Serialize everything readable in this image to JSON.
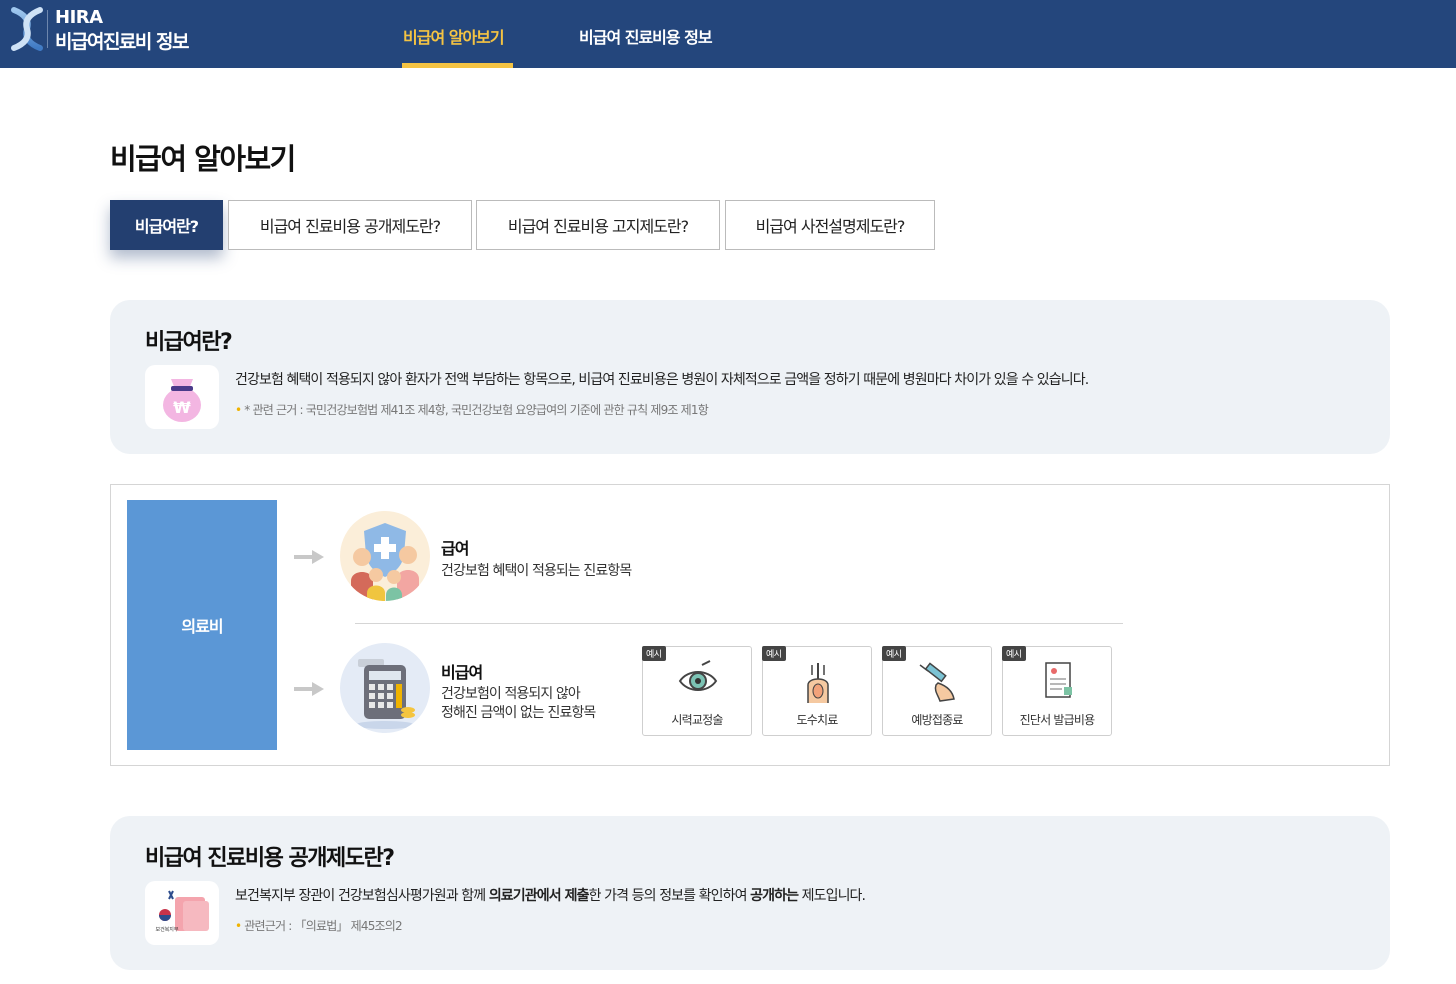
{
  "header": {
    "logo_line1": "HIRA",
    "logo_line2": "비급여진료비 정보",
    "nav": [
      {
        "label": "비급여 알아보기",
        "active": true
      },
      {
        "label": "비급여 진료비용 정보",
        "active": false
      }
    ]
  },
  "page_title": "비급여 알아보기",
  "tabs": [
    {
      "label": "비급여란?",
      "active": true
    },
    {
      "label": "비급여 진료비용 공개제도란?",
      "active": false
    },
    {
      "label": "비급여 진료비용 고지제도란?",
      "active": false
    },
    {
      "label": "비급여 사전설명제도란?",
      "active": false
    }
  ],
  "section1": {
    "title": "비급여란?",
    "icon": "money-bag-icon",
    "description": "건강보험 혜택이 적용되지 않아 환자가 전액 부담하는 항목으로, 비급여 진료비용은 병원이 자체적으로 금액을 정하기 때문에 병원마다 차이가 있을 수 있습니다.",
    "note": "* 관련 근거 : 국민건강보험법 제41조 제4항, 국민건강보험 요양급여의 기준에 관한 규칙 제9조 제1항"
  },
  "diagram": {
    "root_label": "의료비",
    "covered": {
      "title": "급여",
      "description": "건강보험 혜택이 적용되는 진료항목",
      "icon": "family-shield-icon"
    },
    "non_covered": {
      "title": "비급여",
      "description_line1": "건강보험이 적용되지 않아",
      "description_line2": "정해진 금액이 없는 진료항목",
      "icon": "calculator-icon"
    },
    "examples": [
      {
        "badge": "예시",
        "label": "시력교정술",
        "icon": "eye-icon"
      },
      {
        "badge": "예시",
        "label": "도수치료",
        "icon": "massage-icon"
      },
      {
        "badge": "예시",
        "label": "예방접종료",
        "icon": "syringe-icon"
      },
      {
        "badge": "예시",
        "label": "진단서 발급비용",
        "icon": "certificate-icon"
      }
    ]
  },
  "section2": {
    "title": "비급여 진료비용 공개제도란?",
    "icon": "ministry-card-icon",
    "desc_part1": "보건복지부 장관이 건강보험심사평가원과 함께 ",
    "desc_bold1": "의료기관에서 제출",
    "desc_part2": "한 가격 등의 정보를 확인하여 ",
    "desc_bold2": "공개하는",
    "desc_part3": " 제도입니다.",
    "note": "관련근거 : 「의료법」 제45조의2",
    "logo_caption": "보건복지부"
  },
  "colors": {
    "header_bg": "#24467c",
    "nav_active": "#f4c343",
    "tab_active_bg": "#233f70",
    "info_bg": "#eef2f6",
    "cost_box": "#5b97d6"
  }
}
